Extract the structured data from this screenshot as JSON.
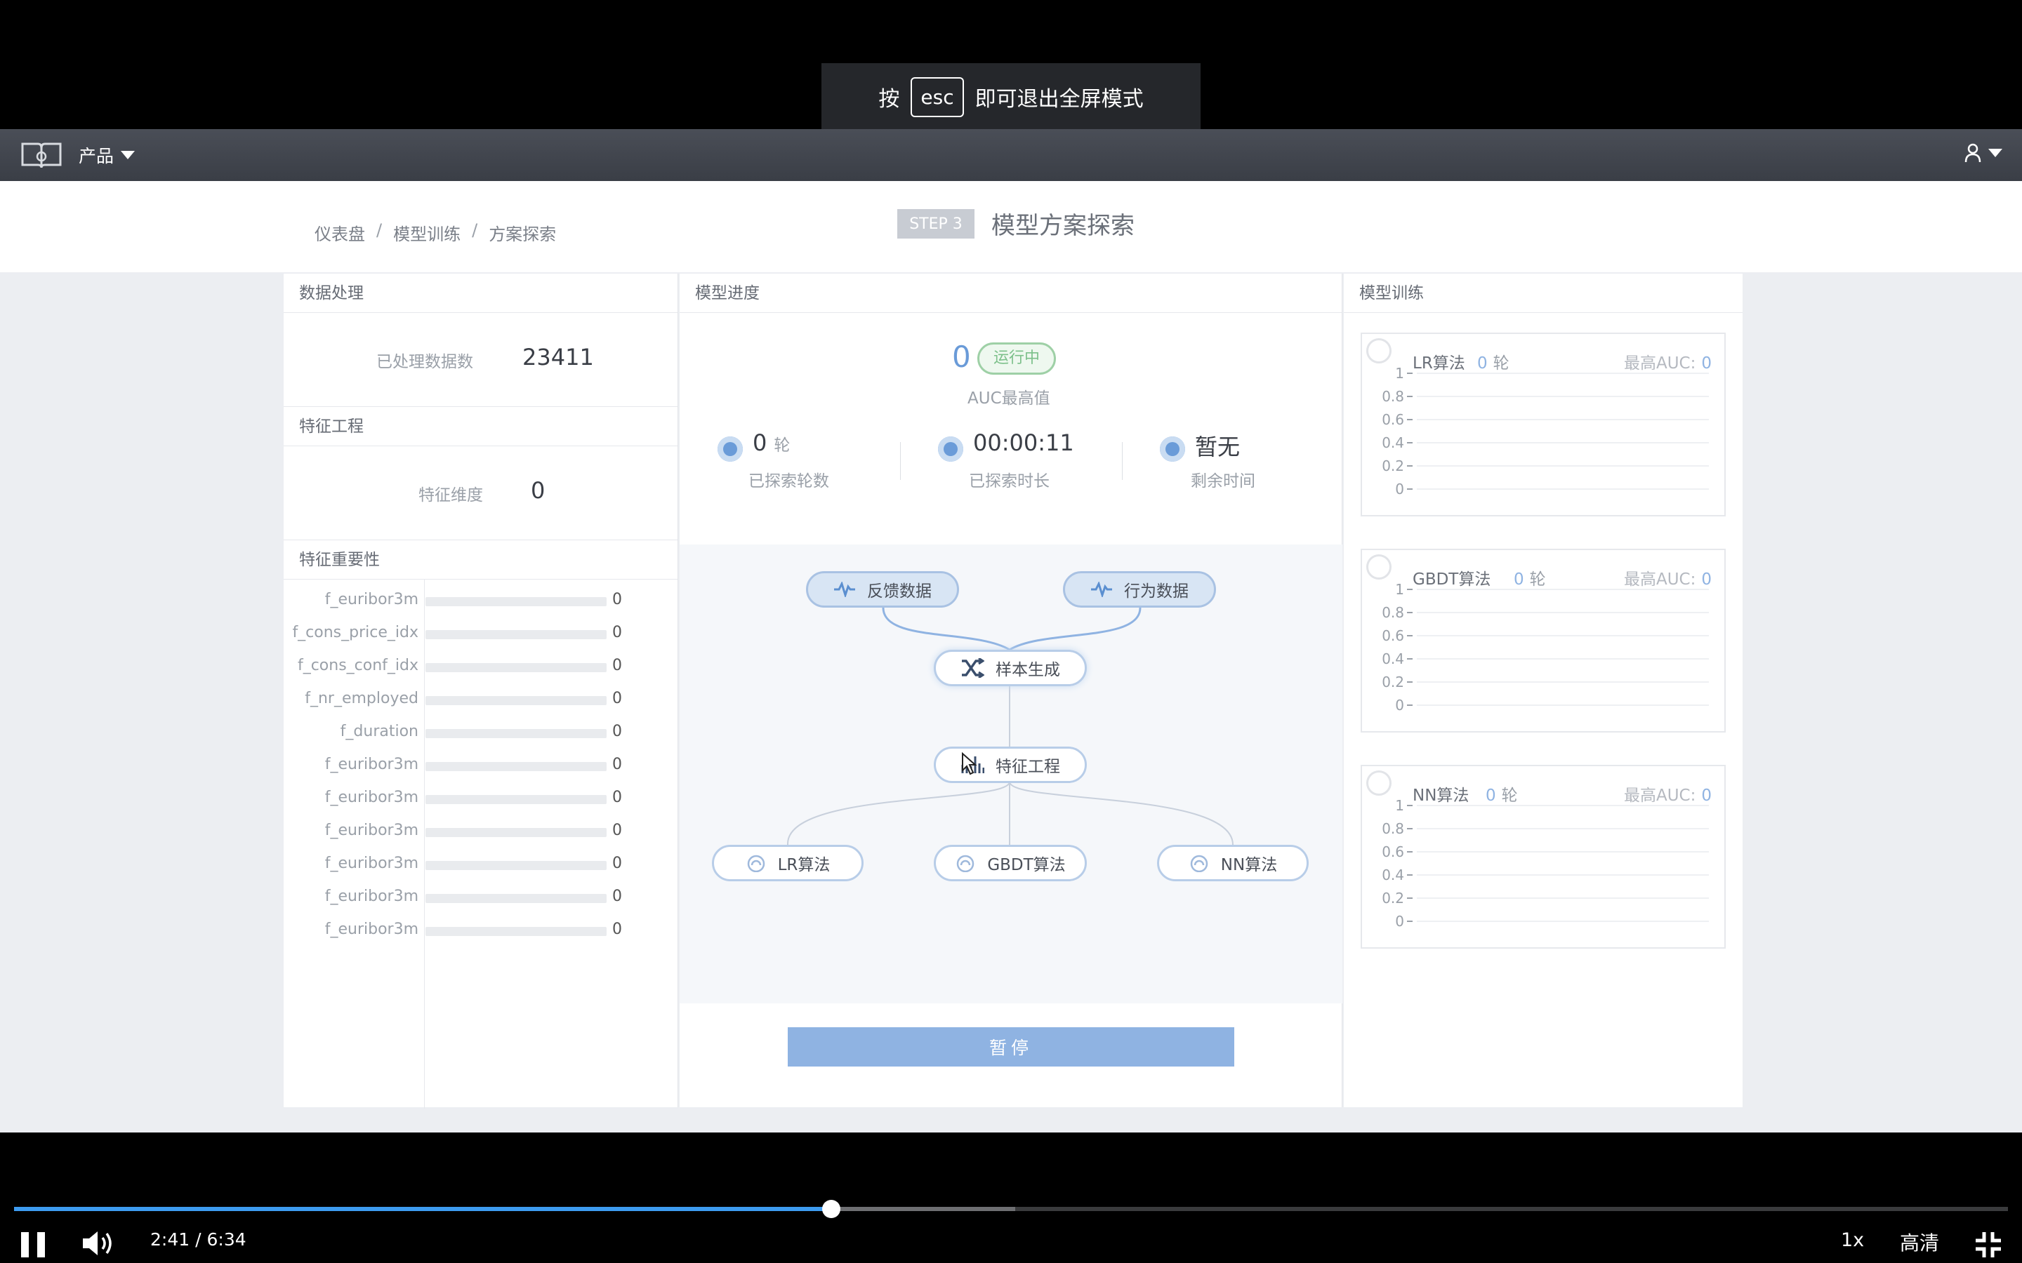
{
  "toast": {
    "prefix": "按",
    "key": "esc",
    "suffix": "即可退出全屏模式"
  },
  "navbar": {
    "product_label": "产品"
  },
  "breadcrumb": {
    "items": [
      "仪表盘",
      "模型训练",
      "方案探索"
    ],
    "separator": "/"
  },
  "step": {
    "badge": "STEP 3",
    "title": "模型方案探索"
  },
  "data_panel": {
    "title": "数据处理",
    "processed_label": "已处理数据数",
    "processed_value": "23411",
    "feature_title": "特征工程",
    "dimension_label": "特征维度",
    "dimension_value": "0",
    "importance_title": "特征重要性",
    "features": [
      {
        "name": "f_euribor3m",
        "value": "0",
        "fraction": 0
      },
      {
        "name": "f_cons_price_idx",
        "value": "0",
        "fraction": 0
      },
      {
        "name": "f_cons_conf_idx",
        "value": "0",
        "fraction": 0
      },
      {
        "name": "f_nr_employed",
        "value": "0",
        "fraction": 0
      },
      {
        "name": "f_duration",
        "value": "0",
        "fraction": 0
      },
      {
        "name": "f_euribor3m",
        "value": "0",
        "fraction": 0
      },
      {
        "name": "f_euribor3m",
        "value": "0",
        "fraction": 0
      },
      {
        "name": "f_euribor3m",
        "value": "0",
        "fraction": 0
      },
      {
        "name": "f_euribor3m",
        "value": "0",
        "fraction": 0
      },
      {
        "name": "f_euribor3m",
        "value": "0",
        "fraction": 0
      },
      {
        "name": "f_euribor3m",
        "value": "0",
        "fraction": 0
      }
    ]
  },
  "progress_panel": {
    "title": "模型进度",
    "auc_value": "0",
    "status": "运行中",
    "auc_label": "AUC最高值",
    "metrics": [
      {
        "value": "0",
        "unit": "轮",
        "label": "已探索轮数"
      },
      {
        "value": "00:00:11",
        "unit": "",
        "label": "已探索时长"
      },
      {
        "value": "暂无",
        "unit": "",
        "label": "剩余时间"
      }
    ],
    "flow": {
      "feedback": "反馈数据",
      "behavior": "行为数据",
      "sample": "样本生成",
      "feature": "特征工程",
      "lr": "LR算法",
      "gbdt": "GBDT算法",
      "nn": "NN算法"
    },
    "pause_label": "暂停"
  },
  "training_panel": {
    "title": "模型训练",
    "y_ticks": [
      "1",
      "0.8",
      "0.6",
      "0.4",
      "0.2",
      "0"
    ],
    "algorithms": [
      {
        "name": "LR算法",
        "rounds": "0",
        "unit": "轮",
        "auc_label": "最高AUC:",
        "auc_value": "0"
      },
      {
        "name": "GBDT算法",
        "rounds": "0",
        "unit": "轮",
        "auc_label": "最高AUC:",
        "auc_value": "0"
      },
      {
        "name": "NN算法",
        "rounds": "0",
        "unit": "轮",
        "auc_label": "最高AUC:",
        "auc_value": "0"
      }
    ]
  },
  "player": {
    "current_time": "2:41",
    "duration": "6:34",
    "time_separator": "/",
    "played_fraction": 0.41,
    "buffered_fraction": 0.502,
    "speed": "1x",
    "quality": "高清"
  },
  "colors": {
    "accent": "#6a9bd8",
    "progress": "#3d9bf0",
    "status_green": "#7cc08a"
  }
}
